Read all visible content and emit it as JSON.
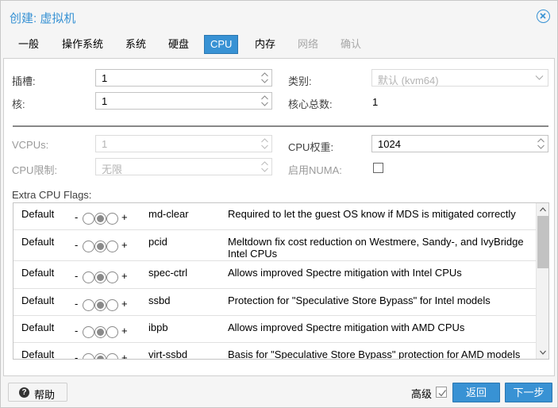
{
  "window": {
    "title": "创建: 虚拟机"
  },
  "tabs": [
    {
      "label": "一般",
      "state": "normal"
    },
    {
      "label": "操作系统",
      "state": "normal"
    },
    {
      "label": "系统",
      "state": "normal"
    },
    {
      "label": "硬盘",
      "state": "normal"
    },
    {
      "label": "CPU",
      "state": "active"
    },
    {
      "label": "内存",
      "state": "normal"
    },
    {
      "label": "网络",
      "state": "disabled"
    },
    {
      "label": "确认",
      "state": "disabled"
    }
  ],
  "form": {
    "sockets": {
      "label": "插槽:",
      "value": "1"
    },
    "type": {
      "label": "类别:",
      "value": "默认 (kvm64)"
    },
    "cores": {
      "label": "核:",
      "value": "1"
    },
    "total_cores": {
      "label": "核心总数:",
      "value": "1"
    },
    "vcpus": {
      "label": "VCPUs:",
      "value": "1"
    },
    "cpu_weight": {
      "label": "CPU权重:",
      "value": "1024"
    },
    "cpu_limit": {
      "label": "CPU限制:",
      "value": "无限"
    },
    "numa": {
      "label": "启用NUMA:",
      "checked": false
    }
  },
  "flags": {
    "label": "Extra CPU Flags:",
    "minus": "-",
    "plus": "+",
    "rows": [
      {
        "default": "Default",
        "name": "md-clear",
        "description": "Required to let the guest OS know if MDS is mitigated correctly"
      },
      {
        "default": "Default",
        "name": "pcid",
        "description": "Meltdown fix cost reduction on Westmere, Sandy-, and IvyBridge Intel CPUs"
      },
      {
        "default": "Default",
        "name": "spec-ctrl",
        "description": "Allows improved Spectre mitigation with Intel CPUs"
      },
      {
        "default": "Default",
        "name": "ssbd",
        "description": "Protection for \"Speculative Store Bypass\" for Intel models"
      },
      {
        "default": "Default",
        "name": "ibpb",
        "description": "Allows improved Spectre mitigation with AMD CPUs"
      },
      {
        "default": "Default",
        "name": "virt-ssbd",
        "description": "Basis for \"Speculative Store Bypass\" protection for AMD models"
      }
    ]
  },
  "footer": {
    "help": "帮助",
    "advanced": "高级",
    "advanced_checked": true,
    "back": "返回",
    "next": "下一步"
  },
  "colors": {
    "accent": "#3892d4"
  }
}
